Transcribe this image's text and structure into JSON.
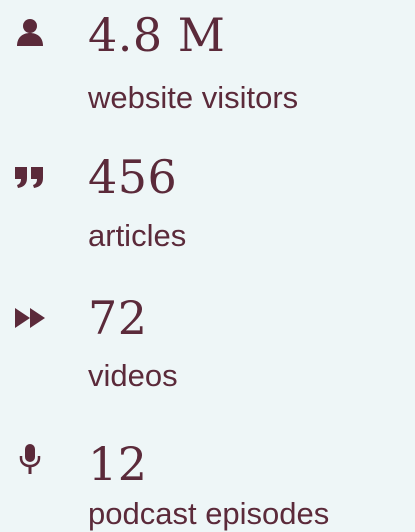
{
  "stats": [
    {
      "icon": "user-icon",
      "value": "4.8 M",
      "label": "website visitors"
    },
    {
      "icon": "quote-icon",
      "value": "456",
      "label": "articles"
    },
    {
      "icon": "fast-forward-icon",
      "value": "72",
      "label": "videos"
    },
    {
      "icon": "microphone-icon",
      "value": "12",
      "label": "podcast episodes"
    }
  ],
  "colors": {
    "background": "#eef6f7",
    "text": "#5b2a3a"
  }
}
